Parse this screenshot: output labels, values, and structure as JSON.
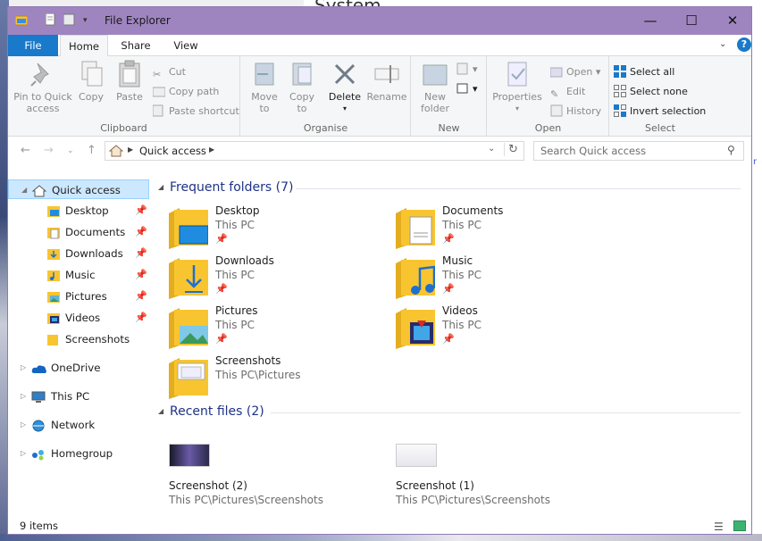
{
  "window": {
    "title": "File Explorer"
  },
  "background": {
    "behind_title": "System"
  },
  "ribbon_tabs": {
    "file": "File",
    "home": "Home",
    "share": "Share",
    "view": "View"
  },
  "ribbon": {
    "clipboard": {
      "pin_label_1": "Pin to Quick",
      "pin_label_2": "access",
      "copy": "Copy",
      "paste": "Paste",
      "cut": "Cut",
      "copy_path": "Copy path",
      "paste_shortcut": "Paste shortcut",
      "group": "Clipboard"
    },
    "organise": {
      "move_to_1": "Move",
      "move_to_2": "to",
      "copy_to_1": "Copy",
      "copy_to_2": "to",
      "delete": "Delete",
      "rename": "Rename",
      "group": "Organise"
    },
    "new": {
      "new_folder_1": "New",
      "new_folder_2": "folder",
      "group": "New"
    },
    "open": {
      "properties": "Properties",
      "open": "Open",
      "edit": "Edit",
      "history": "History",
      "group": "Open"
    },
    "select": {
      "select_all": "Select all",
      "select_none": "Select none",
      "invert": "Invert selection",
      "group": "Select"
    }
  },
  "address": {
    "path": "Quick access",
    "search_placeholder": "Search Quick access"
  },
  "nav": {
    "quick_access": "Quick access",
    "pinned": [
      {
        "label": "Desktop",
        "icon": "desktop-folder-icon",
        "pinned": true
      },
      {
        "label": "Documents",
        "icon": "documents-folder-icon",
        "pinned": true
      },
      {
        "label": "Downloads",
        "icon": "downloads-folder-icon",
        "pinned": true
      },
      {
        "label": "Music",
        "icon": "music-folder-icon",
        "pinned": true
      },
      {
        "label": "Pictures",
        "icon": "pictures-folder-icon",
        "pinned": true
      },
      {
        "label": "Videos",
        "icon": "videos-folder-icon",
        "pinned": true
      },
      {
        "label": "Screenshots",
        "icon": "folder-icon",
        "pinned": false
      }
    ],
    "onedrive": "OneDrive",
    "this_pc": "This PC",
    "network": "Network",
    "homegroup": "Homegroup"
  },
  "content": {
    "frequent_header": "Frequent folders (7)",
    "folders": [
      {
        "name": "Desktop",
        "location": "This PC"
      },
      {
        "name": "Documents",
        "location": "This PC"
      },
      {
        "name": "Downloads",
        "location": "This PC"
      },
      {
        "name": "Music",
        "location": "This PC"
      },
      {
        "name": "Pictures",
        "location": "This PC"
      },
      {
        "name": "Videos",
        "location": "This PC"
      },
      {
        "name": "Screenshots",
        "location": "This PC\\Pictures"
      }
    ],
    "recent_header": "Recent files (2)",
    "files": [
      {
        "name": "Screenshot (2)",
        "location": "This PC\\Pictures\\Screenshots"
      },
      {
        "name": "Screenshot (1)",
        "location": "This PC\\Pictures\\Screenshots"
      }
    ]
  },
  "status": {
    "item_count": "9 items"
  },
  "colors": {
    "titlebar": "#9f85c0",
    "file_tab": "#1979ca",
    "selection": "#cce8ff",
    "section_heading": "#1e3287",
    "folder": "#f8c530"
  }
}
